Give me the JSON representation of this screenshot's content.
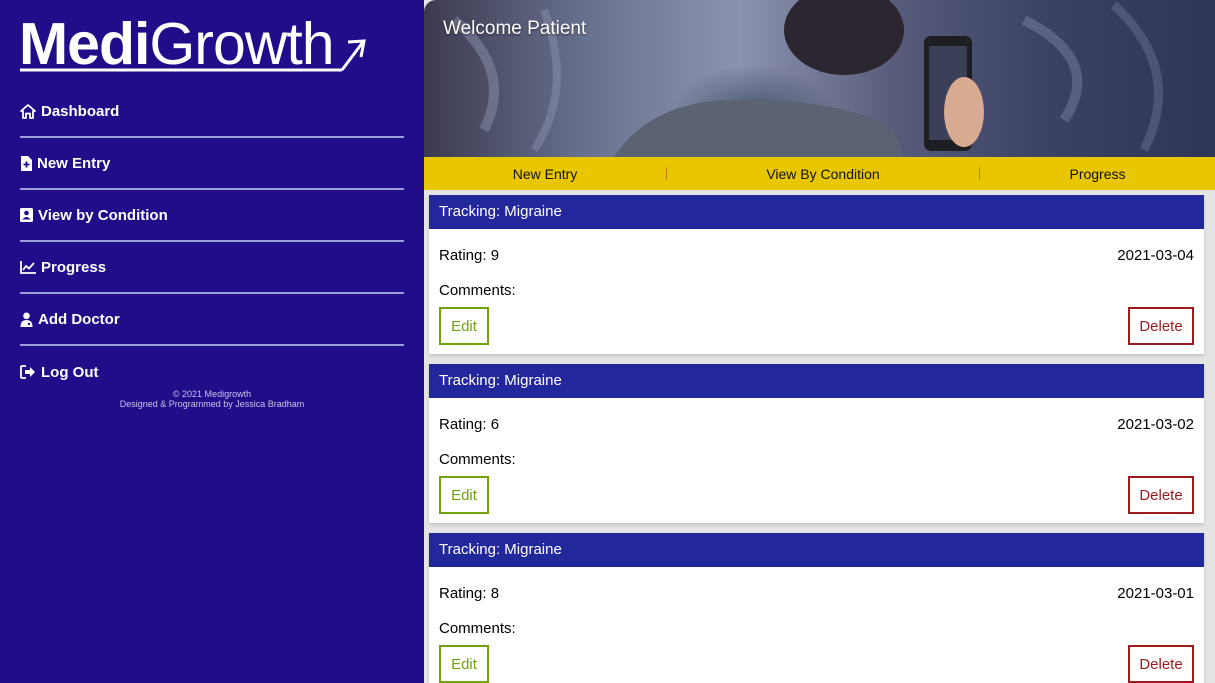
{
  "brand": {
    "bold": "Medi",
    "regular": "Growth"
  },
  "nav": [
    {
      "label": "Dashboard",
      "icon": "home-icon"
    },
    {
      "label": "New Entry",
      "icon": "file-plus-icon"
    },
    {
      "label": "View by Condition",
      "icon": "id-card-icon"
    },
    {
      "label": "Progress",
      "icon": "chart-line-icon"
    },
    {
      "label": "Add Doctor",
      "icon": "doctor-icon"
    },
    {
      "label": "Log Out",
      "icon": "logout-icon"
    }
  ],
  "footer": {
    "copyright": "© 2021 Medigrowth",
    "credit": "Designed & Programmed by Jessica Bradham"
  },
  "hero": {
    "title": "Welcome Patient"
  },
  "tabs": [
    "New Entry",
    "View By Condition",
    "Progress"
  ],
  "entry_labels": {
    "tracking": "Tracking: Migraine",
    "comments": "Comments:",
    "edit": "Edit",
    "delete": "Delete"
  },
  "entries": [
    {
      "rating": "Rating: 9",
      "date": "2021-03-04"
    },
    {
      "rating": "Rating: 6",
      "date": "2021-03-02"
    },
    {
      "rating": "Rating: 8",
      "date": "2021-03-01"
    }
  ],
  "colors": {
    "sidebar": "#1f0d8a",
    "card_header": "#22279c",
    "tabbar": "#e9c700",
    "edit": "#6fa20c",
    "delete": "#9b1b1b"
  }
}
